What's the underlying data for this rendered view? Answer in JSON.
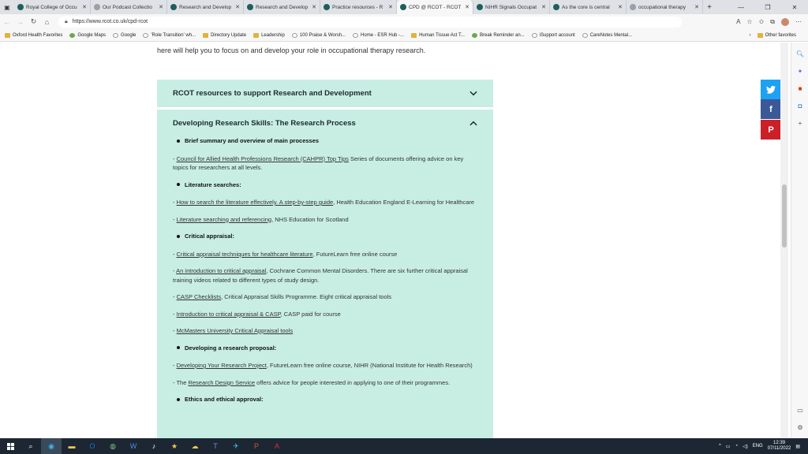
{
  "tabs": [
    {
      "title": "Royal College of Occu",
      "active": false
    },
    {
      "title": "Our Podcast Collectio",
      "active": false
    },
    {
      "title": "Research and Develop",
      "active": false
    },
    {
      "title": "Research and Develop",
      "active": false
    },
    {
      "title": "Practice resources - R",
      "active": false
    },
    {
      "title": "CPD @ RCOT - RCOT",
      "active": true
    },
    {
      "title": "NIHR Signals Occupat",
      "active": false
    },
    {
      "title": "As the core is central",
      "active": false
    },
    {
      "title": "occupational therapy",
      "active": false
    }
  ],
  "url": "https://www.rcot.co.uk/cpd-rcot",
  "bookmarks": [
    "Oxford Health Favorites",
    "Google Maps",
    "Google",
    "'Role Transition' wh...",
    "Directory Update",
    "Leadership",
    "100 Praise & Worsh...",
    "Home - ESR Hub -...",
    "Human Tissue Act T...",
    "Break Reminder an...",
    "iSupport account",
    "CareNotes Mental..."
  ],
  "other_favorites": "Other favorites",
  "intro_text": "here will help you to focus on and develop your role in occupational therapy research.",
  "accordion1_title": "RCOT resources to support Research and Development",
  "accordion2_title": "Developing Research Skills: The Research Process",
  "content": {
    "b1": "Brief summary and overview of main processes",
    "e1_link": "Council for Allied Health Professions Research (CAHPR) Top Tips",
    "e1_text": " Series of documents offering advice on key topics for researchers at all levels.",
    "b2": "Literature searches:",
    "e2_link": "How to search the literature effectively. A step-by-step guide",
    "e2_text": ", Health Education England E-Learning for Healthcare",
    "e3_link": "Literature searching and referencing",
    "e3_text": ", NHS Education for Scotland",
    "b3": "Critical appraisal:",
    "e4_link": "Critical appraisal techniques for healthcare literature",
    "e4_text": ", FutureLearn free online course",
    "e5_link": "An introduction to critical appraisal",
    "e5_text": ", Cochrane Common Mental Disorders. There are six further critical appraisal training videos related to different types of study design.",
    "e6_link": "CASP Checklists",
    "e6_text": ", Critical Appraisal Skills Programme. Eight critical appraisal tools",
    "e7_link": "Introduction to critical appraisal & CASP",
    "e7_text": ", CASP paid for course",
    "e8_link": "McMasters University Critical Appraisal tools",
    "b4": "Developing a research proposal:",
    "e9_link": "Developing Your Research Project",
    "e9_text": ", FutureLearn free online course, NIHR (National Institute for Health Research)",
    "e10_pre": "- The ",
    "e10_link": "Research Design Service",
    "e10_text": " offers advice for people interested in applying to one of their programmes.",
    "b5": "Ethics and ethical approval:",
    "dash": "- "
  },
  "tray": {
    "lang": "ENG",
    "time": "12:39",
    "date": "07/11/2022"
  }
}
